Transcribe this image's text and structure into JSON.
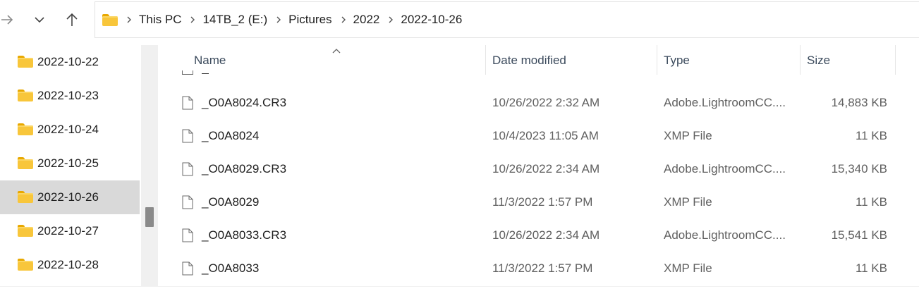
{
  "nav": {
    "forward_icon": "arrow-right-icon",
    "recent_icon": "chevron-down-icon",
    "up_icon": "arrow-up-icon"
  },
  "address": {
    "folder_icon": "folder-icon",
    "crumbs": [
      "This PC",
      "14TB_2 (E:)",
      "Pictures",
      "2022",
      "2022-10-26"
    ]
  },
  "sidebar": {
    "items": [
      {
        "label": "2022-10-22",
        "selected": false
      },
      {
        "label": "2022-10-23",
        "selected": false
      },
      {
        "label": "2022-10-24",
        "selected": false
      },
      {
        "label": "2022-10-25",
        "selected": false
      },
      {
        "label": "2022-10-26",
        "selected": true
      },
      {
        "label": "2022-10-27",
        "selected": false
      },
      {
        "label": "2022-10-28",
        "selected": false
      }
    ]
  },
  "columns": {
    "name": "Name",
    "date": "Date modified",
    "type": "Type",
    "size": "Size"
  },
  "files": [
    {
      "name": "_O0A8024.CR3",
      "date": "10/26/2022 2:32 AM",
      "type": "Adobe.LightroomCC....",
      "size": "14,883 KB"
    },
    {
      "name": "_O0A8024",
      "date": "10/4/2023 11:05 AM",
      "type": "XMP File",
      "size": "11 KB"
    },
    {
      "name": "_O0A8029.CR3",
      "date": "10/26/2022 2:34 AM",
      "type": "Adobe.LightroomCC....",
      "size": "15,340 KB"
    },
    {
      "name": "_O0A8029",
      "date": "11/3/2022 1:57 PM",
      "type": "XMP File",
      "size": "11 KB"
    },
    {
      "name": "_O0A8033.CR3",
      "date": "10/26/2022 2:34 AM",
      "type": "Adobe.LightroomCC....",
      "size": "15,541 KB"
    },
    {
      "name": "_O0A8033",
      "date": "11/3/2022 1:57 PM",
      "type": "XMP File",
      "size": "11 KB"
    }
  ],
  "colors": {
    "selected_bg": "#d9d9d9",
    "folder_yellow": "#f8c63b",
    "header_text": "#3b4a5c"
  }
}
